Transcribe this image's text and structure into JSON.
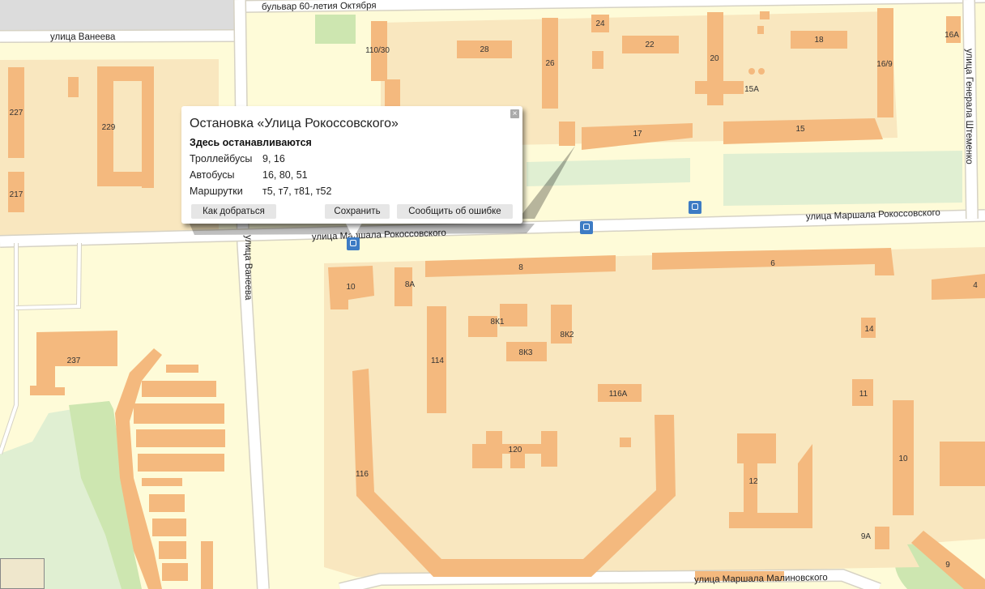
{
  "colors": {
    "background": "#fefbd8",
    "block": "#f9e7bf",
    "building": "#f4b97e",
    "park": "#cde6b0",
    "bus_stop": "#3d7bc4"
  },
  "streets": {
    "boulevard_60": "бульвар 60-летия Октября",
    "vaneeva_h": "улица Ванеева",
    "vaneeva_v": "улица Ванеева",
    "rokossovskogo_right": "улица Маршала Рокоссовского",
    "rokossovskogo_left": "улица Маршала Рокоссовского",
    "shtemenko": "улица Генерала Штеменко",
    "malinovskogo": "улица Маршала Малиновского"
  },
  "buildings": [
    "110/30",
    "28",
    "24",
    "22",
    "26",
    "20",
    "18",
    "16A",
    "16/9",
    "15A",
    "17",
    "15",
    "227",
    "229",
    "217",
    "8",
    "6",
    "10",
    "8A",
    "4",
    "8К1",
    "8К2",
    "8К3",
    "14",
    "114",
    "116А",
    "11",
    "120",
    "10",
    "12",
    "116",
    "237",
    "9А",
    "9"
  ],
  "popup": {
    "title": "Остановка «Улица Рокоссовского»",
    "subtitle": "Здесь останавливаются",
    "rows": [
      {
        "type": "Троллейбусы",
        "routes": "9, 16"
      },
      {
        "type": "Автобусы",
        "routes": "16, 80, 51"
      },
      {
        "type": "Маршрутки",
        "routes": "т5, т7, т81, т52"
      }
    ],
    "buttons": {
      "directions": "Как добраться",
      "save": "Сохранить",
      "report": "Сообщить об ошибке"
    },
    "close_icon": "close-icon"
  },
  "icons": [
    "bus-stop-icon",
    "close-icon"
  ]
}
